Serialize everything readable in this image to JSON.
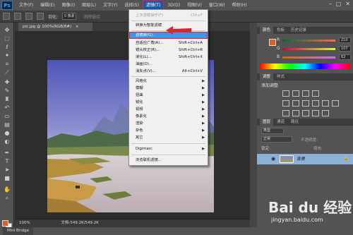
{
  "app": {
    "logo": "Ps",
    "win_controls": [
      "–",
      "□",
      "✕"
    ]
  },
  "menubar": {
    "items": [
      "文件(F)",
      "编辑(E)",
      "图像(I)",
      "图层(L)",
      "文字(Y)",
      "选择(S)",
      "滤镜(T)",
      "3D(D)",
      "视图(V)",
      "窗口(W)",
      "帮助(H)"
    ],
    "active_index": 6
  },
  "options": {
    "feather_label": "羽化:",
    "feather_value": "0 像素",
    "antialias_label": "消除锯齿"
  },
  "document": {
    "tab_title": "pic.jpg @ 100%(RGB/8#)",
    "close_glyph": "×"
  },
  "status": {
    "zoom": "100%",
    "doc_info": "文档:549.2K/549.2K"
  },
  "filter_menu": {
    "items": [
      {
        "label": "上次滤镜操作(F)",
        "shortcut": "Ctrl+F",
        "disabled": true
      },
      {
        "label": "转换为智能滤镜",
        "shortcut": ""
      },
      {
        "label": "滤镜库(G)...",
        "shortcut": "",
        "highlighted": true
      },
      {
        "label": "自适应广角(A)...",
        "shortcut": "Shift+Ctrl+A"
      },
      {
        "label": "镜头校正(R)...",
        "shortcut": "Shift+Ctrl+R"
      },
      {
        "label": "液化(L)...",
        "shortcut": "Shift+Ctrl+X"
      },
      {
        "label": "油画(O)...",
        "shortcut": ""
      },
      {
        "label": "消失点(V)...",
        "shortcut": "Alt+Ctrl+V"
      },
      {
        "label": "风格化",
        "submenu": true
      },
      {
        "label": "模糊",
        "submenu": true
      },
      {
        "label": "扭曲",
        "submenu": true
      },
      {
        "label": "锐化",
        "submenu": true
      },
      {
        "label": "视频",
        "submenu": true
      },
      {
        "label": "像素化",
        "submenu": true
      },
      {
        "label": "渲染",
        "submenu": true
      },
      {
        "label": "杂色",
        "submenu": true
      },
      {
        "label": "其它",
        "submenu": true
      },
      {
        "label": "Digimarc",
        "submenu": true
      },
      {
        "label": "浏览联机滤镜...",
        "shortcut": ""
      }
    ]
  },
  "panels": {
    "color_tabs": [
      "颜色",
      "色板",
      "历史记录"
    ],
    "rgb": [
      {
        "letter": "R",
        "value": "210"
      },
      {
        "letter": "G",
        "value": "107"
      },
      {
        "letter": "B",
        "value": "62"
      }
    ],
    "adjust_tabs": [
      "调整",
      "样式"
    ],
    "adjust_title": "添加调整",
    "layers_tabs": [
      "图层",
      "通道",
      "路径"
    ],
    "layers_kind": "类型",
    "layers_mode": "正常",
    "layers_opacity": "不透明度:",
    "layers_lock": "锁定:",
    "layers_fill": "填充:",
    "layer_name": "背景"
  },
  "bottombar": {
    "tab_label": "Mini Bridge"
  },
  "watermark": {
    "main": "Bai du 经验",
    "sub": "jingyan.baidu.com"
  },
  "icons": [
    "move-icon",
    "marquee-icon",
    "lasso-icon",
    "magic-wand-icon",
    "crop-icon",
    "eyedropper-icon",
    "healing-icon",
    "brush-icon",
    "stamp-icon",
    "history-brush-icon",
    "eraser-icon",
    "gradient-icon",
    "blur-icon",
    "dodge-icon",
    "pen-icon",
    "type-icon",
    "path-select-icon",
    "shape-icon",
    "hand-icon",
    "zoom-icon"
  ],
  "colors": {
    "menu_active": "#1a5aa6",
    "highlight": "#3e96e6",
    "red_marker": "#e2222a",
    "foreground": "#d8602e"
  }
}
